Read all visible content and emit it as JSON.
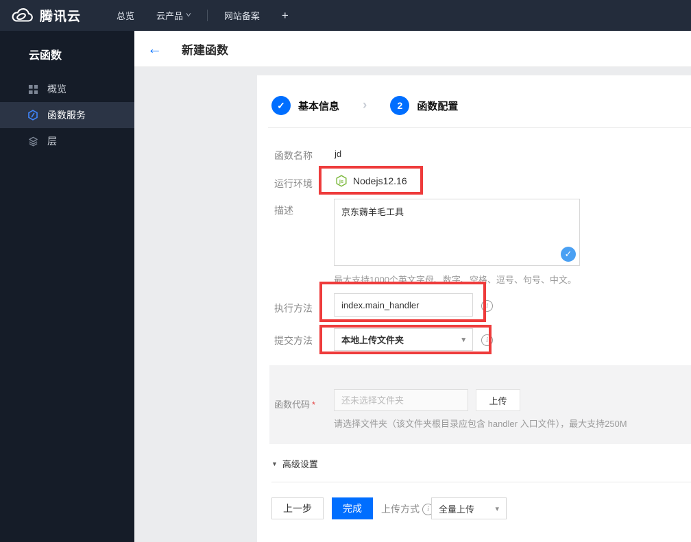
{
  "colors": {
    "accent_blue": "#006eff",
    "textarea_check_blue": "#4aa0f3",
    "annotation_red": "#ee3b3b",
    "node_green": "#7fba41",
    "topbar_bg": "#232c3b",
    "sidebar_bg": "#151c28",
    "sidebar_active_bg": "#2b3445",
    "page_bg": "#ebecee",
    "panel_bg": "#f3f3f4"
  },
  "icons": {
    "back": "←",
    "check": "✓",
    "caret_down": "▾",
    "nav_caret": "˅",
    "section_caret": "▼",
    "info": "i",
    "step_chevron": "›",
    "required": "*"
  },
  "topbar": {
    "brand": "腾讯云",
    "nav": [
      {
        "label": "总览"
      },
      {
        "label": "云产品"
      },
      {
        "label": "网站备案"
      },
      {
        "label": "+"
      }
    ]
  },
  "sidebar": {
    "title": "云函数",
    "items": [
      {
        "label": "概览",
        "icon": "grid-icon",
        "active": false
      },
      {
        "label": "函数服务",
        "icon": "function-hexagon-icon",
        "active": true
      },
      {
        "label": "层",
        "icon": "layers-icon",
        "active": false
      }
    ]
  },
  "header": {
    "title": "新建函数"
  },
  "steps": {
    "step1": {
      "label": "基本信息",
      "state": "completed"
    },
    "step2": {
      "number": "2",
      "label": "函数配置",
      "state": "current"
    }
  },
  "form": {
    "name": {
      "label": "函数名称",
      "value": "jd"
    },
    "runtime": {
      "label": "运行环境",
      "value": "Nodejs12.16"
    },
    "description": {
      "label": "描述",
      "value": "京东薅羊毛工具",
      "hint": "最大支持1000个英文字母、数字、空格、逗号、句号、中文。"
    },
    "handler": {
      "label": "执行方法",
      "value": "index.main_handler"
    },
    "submit_method": {
      "label": "提交方法",
      "value": "本地上传文件夹"
    },
    "code": {
      "label": "函数代码",
      "placeholder": "还未选择文件夹",
      "upload_button": "上传",
      "hint": "请选择文件夹（该文件夹根目录应包含 handler 入口文件），最大支持250M"
    },
    "advanced": {
      "label": "高级设置"
    }
  },
  "footer": {
    "prev_button": "上一步",
    "finish_button": "完成",
    "upload_mode_label": "上传方式",
    "upload_mode_value": "全量上传"
  }
}
